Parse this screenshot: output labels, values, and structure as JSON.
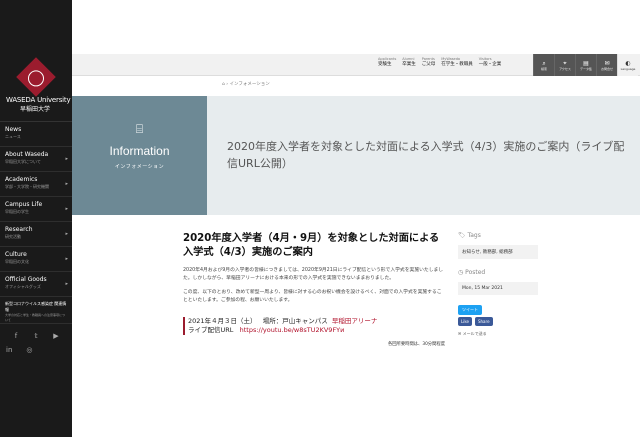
{
  "logo": {
    "en": "WASEDA University",
    "ja": "早稲田大学"
  },
  "sidebar": {
    "items": [
      {
        "label": "News",
        "sub": "ニュース",
        "arrow": false
      },
      {
        "label": "About Waseda",
        "sub": "早稲田大学について",
        "arrow": true
      },
      {
        "label": "Academics",
        "sub": "学部・大学院・研究機関",
        "arrow": true
      },
      {
        "label": "Campus Life",
        "sub": "早稲田の学生",
        "arrow": true
      },
      {
        "label": "Research",
        "sub": "研究活動",
        "arrow": true
      },
      {
        "label": "Culture",
        "sub": "早稲田の文化",
        "arrow": true
      },
      {
        "label": "Official Goods",
        "sub": "オフィシャルグッズ",
        "arrow": true
      }
    ],
    "notice_title": "新型コロナウイルス感染症 関連情報",
    "notice_text": "大学の対応と学生・教職員への注意事項について",
    "social_icons": [
      "facebook-icon",
      "twitter-icon",
      "youtube-icon",
      "linkedin-icon",
      "instagram-icon"
    ]
  },
  "topbar": {
    "links": [
      {
        "en": "Applicants",
        "ja": "受験生"
      },
      {
        "en": "Alumni",
        "ja": "卒業生"
      },
      {
        "en": "Parents",
        "ja": "ご父母"
      },
      {
        "en": "MyWaseda",
        "ja": "在学生・教職員"
      },
      {
        "en": "Visitors",
        "ja": "一般・企業"
      }
    ],
    "icons": [
      {
        "name": "search-icon",
        "glyph": "⌕",
        "cap": "検索"
      },
      {
        "name": "access-icon",
        "glyph": "⌖",
        "cap": "アクセス"
      },
      {
        "name": "data-icon",
        "glyph": "▤",
        "cap": "データ集"
      },
      {
        "name": "contact-icon",
        "glyph": "✉",
        "cap": "お問合せ"
      },
      {
        "name": "language-icon",
        "glyph": "◐",
        "cap": "Language"
      }
    ]
  },
  "breadcrumb": {
    "current": "インフォメーション"
  },
  "hero": {
    "icon": "⌸",
    "en": "Information",
    "ja": "インフォメーション",
    "title": "2020年度入学者を対象とした対面による入学式（4/3）実施のご案内（ライブ配信URL公開）"
  },
  "article": {
    "title": "2020年度入学者（4月・9月）を対象とした対面による入学式（4/3）実施のご案内",
    "p1": "2020年4月および9月の入学者の皆様につきましては、2020年9月21日にライブ配信という形で入学式を実施いたしました。しかしながら、早稲田アリーナにおける本来の形での入学式を実施できないままおりました。",
    "p2": "この度、以下のとおり、改めて新型一周より、皆様に対する心のお祝い機会を設けるべく、対面での入学式を実施することといたします。ご参加の程、お願いいたします。",
    "date": "2021年４月３日（土）",
    "place_label": "場所：戸山キャンパス",
    "place": "早稲田アリーナ",
    "live_label": "ライブ配信URL",
    "live_url": "https://youtu.be/w8sTU2KV9FYи",
    "note": "各回所要時間は、30分間程度"
  },
  "meta": {
    "tags_head": "Tags",
    "tags": "お知らせ, 教務部, 総務部",
    "posted_head": "Posted",
    "posted": "Mon, 15 Mar 2021",
    "tweet": "ツイート",
    "like": "Like",
    "share": "Share",
    "mail": "メールで送る"
  },
  "colors": {
    "brand": "#9b1c2e",
    "hero_box": "#6d8995",
    "hero_bg": "#e7ecee",
    "sidebar": "#1a1a1a"
  }
}
